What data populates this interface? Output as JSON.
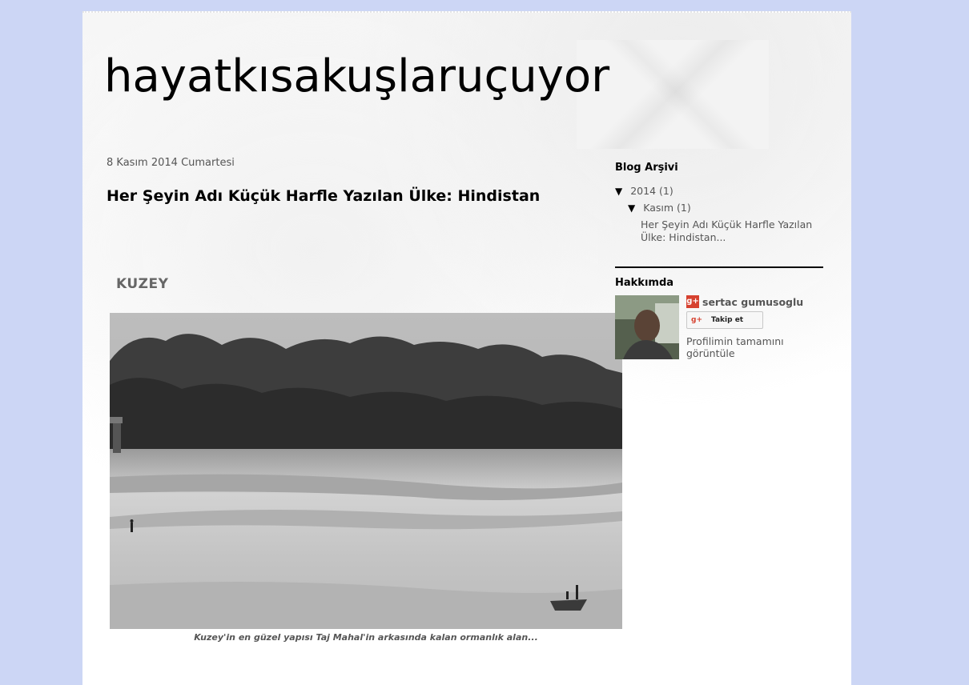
{
  "header": {
    "site_title": "hayatkısakuşlaruçuyor"
  },
  "post": {
    "date": "8 Kasım 2014 Cumartesi",
    "title": "Her Şeyin Adı Küçük Harfle Yazılan Ülke: Hindistan",
    "section_heading": "KUZEY",
    "photo_caption": "Kuzey'in en güzel yapısı Taj Mahal'in arkasında kalan ormanlık alan..."
  },
  "sidebar": {
    "archive": {
      "title": "Blog Arşivi",
      "year_label": "2014",
      "year_count": "(1)",
      "month_label": "Kasım",
      "month_count": "(1)",
      "expanded_icon": "▼",
      "post_link": "Her Şeyin Adı Küçük Harfle Yazılan Ülke: Hindistan..."
    },
    "about": {
      "title": "Hakkımda",
      "name": "sertac gumusoglu",
      "gplus_icon": "g+",
      "follow_label": "Takip et",
      "profile_link": "Profilimin tamamını görüntüle"
    }
  },
  "colors": {
    "background": "#ccd6f5",
    "accent_gplus": "#d6412f",
    "link": "#555555"
  }
}
